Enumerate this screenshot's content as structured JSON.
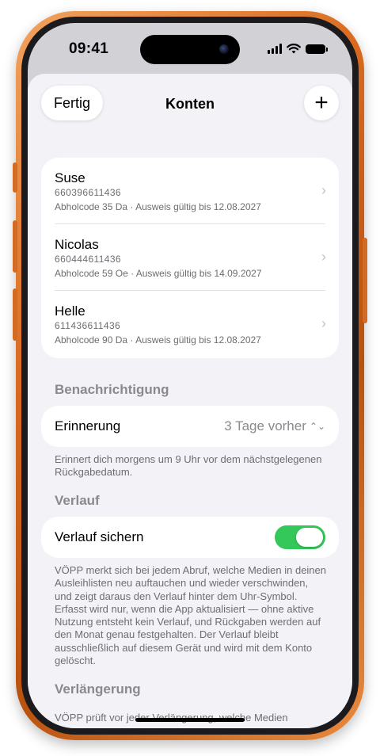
{
  "status_bar": {
    "time": "09:41"
  },
  "nav": {
    "done_label": "Fertig",
    "title": "Konten",
    "add_label": "+"
  },
  "accounts": [
    {
      "name": "Suse",
      "number": "660396611436",
      "detail": "Abholcode 35 Da · Ausweis gültig bis 12.08.2027"
    },
    {
      "name": "Nicolas",
      "number": "660444611436",
      "detail": "Abholcode 59 Oe · Ausweis gültig bis 14.09.2027"
    },
    {
      "name": "Helle",
      "number": "611436611436",
      "detail": "Abholcode 90 Da · Ausweis gültig bis 12.08.2027"
    }
  ],
  "notification": {
    "header": "Benachrichtigung",
    "reminder_label": "Erinnerung",
    "reminder_value": "3 Tage vorher",
    "footer": "Erinnert dich morgens um 9 Uhr vor dem nächstgelegenen Rückgabedatum."
  },
  "history": {
    "header": "Verlauf",
    "toggle_label": "Verlauf sichern",
    "toggle_on": true,
    "footer": "VÖPP merkt sich bei jedem Abruf, welche Medien in deinen Ausleihlisten neu auftauchen und wieder verschwinden, und zeigt daraus den Verlauf hinter dem Uhr-Symbol. Erfasst wird nur, wenn die App aktualisiert — ohne aktive Nutzung entsteht kein Verlauf, und Rückgaben werden auf den Monat genau festgehalten. Der Verlauf bleibt ausschließlich auf diesem Gerät und wird mit dem Konto gelöscht."
  },
  "renewal": {
    "header": "Verlängerung",
    "footer": "VÖPP prüft vor jeder Verlängerung, welche Medien"
  },
  "colors": {
    "toggle_on": "#34c759",
    "frame": "#d86a1f",
    "background": "#f2f2f7"
  }
}
